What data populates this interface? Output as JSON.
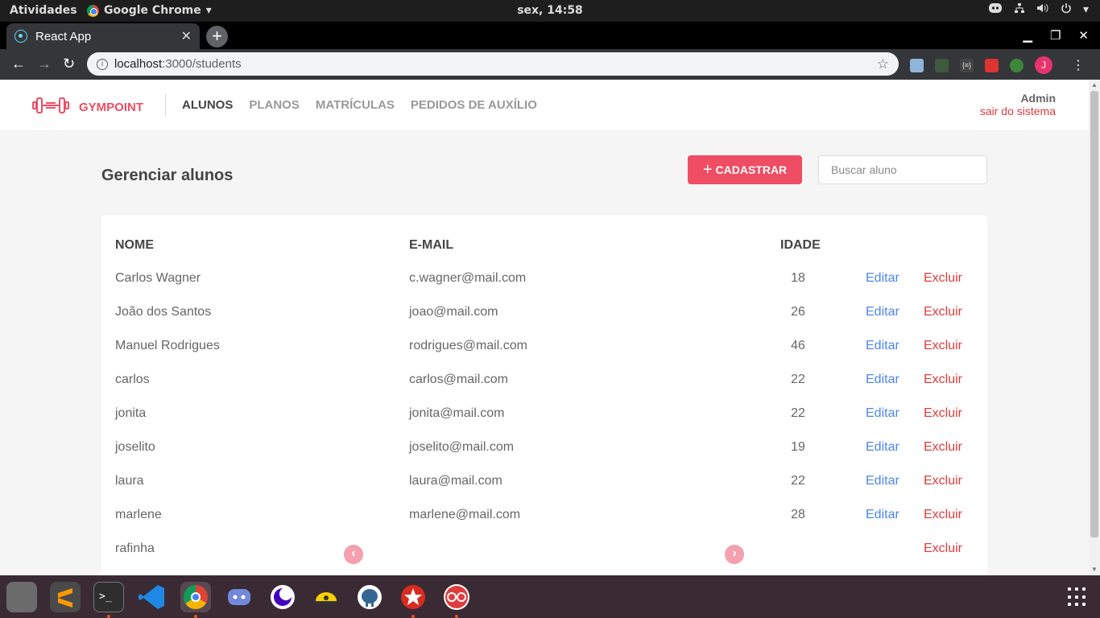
{
  "system": {
    "activities": "Atividades",
    "app_name": "Google Chrome",
    "clock": "sex, 14:58"
  },
  "browser": {
    "tab_title": "React App",
    "url_host": "localhost",
    "url_path": ":3000/students",
    "avatar_letter": "J"
  },
  "app": {
    "brand": "GYMPOINT",
    "nav": [
      "ALUNOS",
      "PLANOS",
      "MATRÍCULAS",
      "PEDIDOS DE AUXÍLIO"
    ],
    "active_nav": "ALUNOS",
    "user_name": "Admin",
    "logout": "sair do sistema"
  },
  "page": {
    "title": "Gerenciar alunos",
    "register_label": "CADASTRAR",
    "search_placeholder": "Buscar aluno"
  },
  "table": {
    "headers": {
      "name": "NOME",
      "email": "E-MAIL",
      "age": "IDADE"
    },
    "edit_label": "Editar",
    "delete_label": "Excluir",
    "rows": [
      {
        "name": "Carlos Wagner",
        "email": "c.wagner@mail.com",
        "age": "18"
      },
      {
        "name": "João dos Santos",
        "email": "joao@mail.com",
        "age": "26"
      },
      {
        "name": "Manuel Rodrigues",
        "email": "rodrigues@mail.com",
        "age": "46"
      },
      {
        "name": "carlos",
        "email": "carlos@mail.com",
        "age": "22"
      },
      {
        "name": "jonita",
        "email": "jonita@mail.com",
        "age": "22"
      },
      {
        "name": "joselito",
        "email": "joselito@mail.com",
        "age": "19"
      },
      {
        "name": "laura",
        "email": "laura@mail.com",
        "age": "22"
      },
      {
        "name": "marlene",
        "email": "marlene@mail.com",
        "age": "28"
      },
      {
        "name": "rafinha",
        "email": "",
        "age": ""
      }
    ]
  },
  "colors": {
    "accent": "#ee4d64",
    "edit": "#4d85ee",
    "delete": "#de3b3b"
  }
}
